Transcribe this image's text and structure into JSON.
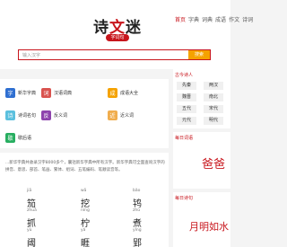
{
  "header": {
    "logo_text_1": "诗",
    "logo_text_2": "文",
    "logo_text_3": "迷",
    "logo_sub": "字词句",
    "nav": [
      "首页",
      "字典",
      "词典",
      "成语",
      "作文",
      "诗词"
    ]
  },
  "search": {
    "placeholder": "输入汉字",
    "button": "搜索"
  },
  "categories": [
    {
      "label": "新华字典",
      "sub": "",
      "color": "#2f6fd1",
      "icon": "字"
    },
    {
      "label": "汉语词典",
      "sub": "",
      "color": "#d9534f",
      "icon": "词"
    },
    {
      "label": "成语大全",
      "sub": "",
      "color": "#f5a200",
      "icon": "成"
    },
    {
      "label": "诗词名句",
      "sub": "",
      "color": "#5bc0de",
      "icon": "诗"
    },
    {
      "label": "反义词",
      "sub": "",
      "color": "#8e44ad",
      "icon": "反"
    },
    {
      "label": "近义词",
      "sub": "",
      "color": "#f0ad4e",
      "icon": "近"
    },
    {
      "label": "歇后语",
      "sub": "",
      "color": "#27ae60",
      "icon": "歇"
    }
  ],
  "intro": {
    "text": "...新华字典共收录汉字8000多个，囊括新华字典中所有汉字。新华字典可全面查询汉字的拼音、意思、部首、笔画、繁体、组词、五笔编码、笔顺读音等。"
  },
  "chars": [
    {
      "c": "笳",
      "p": "jiā"
    },
    {
      "c": "挖",
      "p": "wā"
    },
    {
      "c": "鸨",
      "p": "bǎo"
    },
    {
      "c": "抓",
      "p": "zhuā"
    },
    {
      "c": "柠",
      "p": "níng"
    },
    {
      "c": "煮",
      "p": "zhǔ"
    },
    {
      "c": "阈",
      "p": "yù"
    },
    {
      "c": "睚",
      "p": "yá"
    },
    {
      "c": "郢",
      "p": "yǐng"
    }
  ],
  "right": {
    "poets_title": "古今诗人",
    "eras": [
      "先秦",
      "两汉",
      "魏晋",
      "南北",
      "五代",
      "宋代",
      "元代",
      "明代"
    ],
    "daily_title_1": "每日词语",
    "daily_word_1": "爸爸",
    "daily_title_2": "每日诗句",
    "daily_word_2": "月明如水"
  }
}
